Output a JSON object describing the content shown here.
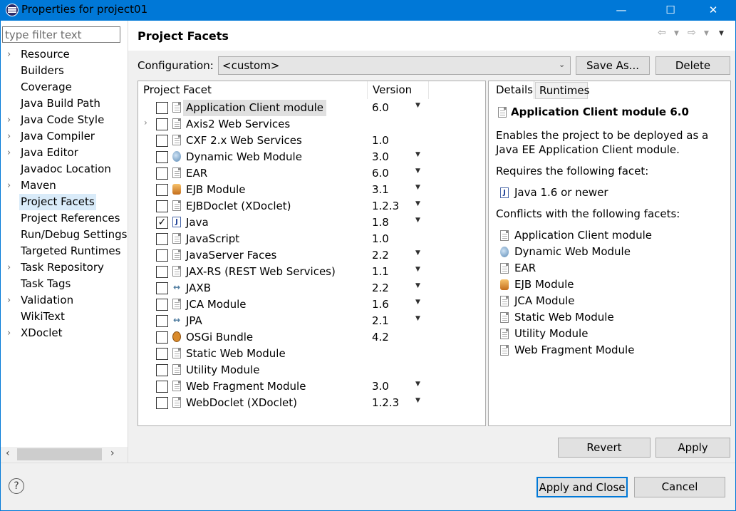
{
  "window": {
    "title": "Properties for project01",
    "minimize": "—",
    "maximize": "☐",
    "close": "✕"
  },
  "filter": {
    "placeholder": "type filter text"
  },
  "nav": [
    {
      "label": "Resource",
      "arrow": "›"
    },
    {
      "label": "Builders",
      "arrow": ""
    },
    {
      "label": "Coverage",
      "arrow": ""
    },
    {
      "label": "Java Build Path",
      "arrow": ""
    },
    {
      "label": "Java Code Style",
      "arrow": "›"
    },
    {
      "label": "Java Compiler",
      "arrow": "›"
    },
    {
      "label": "Java Editor",
      "arrow": "›"
    },
    {
      "label": "Javadoc Location",
      "arrow": ""
    },
    {
      "label": "Maven",
      "arrow": "›"
    },
    {
      "label": "Project Facets",
      "arrow": ""
    },
    {
      "label": "Project References",
      "arrow": ""
    },
    {
      "label": "Run/Debug Settings",
      "arrow": ""
    },
    {
      "label": "Targeted Runtimes",
      "arrow": ""
    },
    {
      "label": "Task Repository",
      "arrow": "›"
    },
    {
      "label": "Task Tags",
      "arrow": ""
    },
    {
      "label": "Validation",
      "arrow": "›"
    },
    {
      "label": "WikiText",
      "arrow": ""
    },
    {
      "label": "XDoclet",
      "arrow": "›"
    }
  ],
  "page": {
    "title": "Project Facets"
  },
  "config": {
    "label": "Configuration:",
    "value": "<custom>",
    "save_as": "Save As...",
    "delete": "Delete"
  },
  "table": {
    "col_facet": "Project Facet",
    "col_version": "Version"
  },
  "facets": [
    {
      "name": "Application Client module",
      "version": "6.0",
      "dropdown": true,
      "checked": false,
      "icon": "page-icon",
      "selected": true
    },
    {
      "name": "Axis2 Web Services",
      "version": "",
      "dropdown": false,
      "checked": false,
      "icon": "page-icon",
      "expander": true
    },
    {
      "name": "CXF 2.x Web Services",
      "version": "1.0",
      "dropdown": false,
      "checked": false,
      "icon": "page-icon"
    },
    {
      "name": "Dynamic Web Module",
      "version": "3.0",
      "dropdown": true,
      "checked": false,
      "icon": "globe-icon"
    },
    {
      "name": "EAR",
      "version": "6.0",
      "dropdown": true,
      "checked": false,
      "icon": "page-icon"
    },
    {
      "name": "EJB Module",
      "version": "3.1",
      "dropdown": true,
      "checked": false,
      "icon": "bean-icon"
    },
    {
      "name": "EJBDoclet (XDoclet)",
      "version": "1.2.3",
      "dropdown": true,
      "checked": false,
      "icon": "page-icon"
    },
    {
      "name": "Java",
      "version": "1.8",
      "dropdown": true,
      "checked": true,
      "icon": "java-icon"
    },
    {
      "name": "JavaScript",
      "version": "1.0",
      "dropdown": false,
      "checked": false,
      "icon": "page-icon"
    },
    {
      "name": "JavaServer Faces",
      "version": "2.2",
      "dropdown": true,
      "checked": false,
      "icon": "page-icon"
    },
    {
      "name": "JAX-RS (REST Web Services)",
      "version": "1.1",
      "dropdown": true,
      "checked": false,
      "icon": "page-icon"
    },
    {
      "name": "JAXB",
      "version": "2.2",
      "dropdown": true,
      "checked": false,
      "icon": "xml-binding-icon"
    },
    {
      "name": "JCA Module",
      "version": "1.6",
      "dropdown": true,
      "checked": false,
      "icon": "page-icon"
    },
    {
      "name": "JPA",
      "version": "2.1",
      "dropdown": true,
      "checked": false,
      "icon": "xml-binding-icon"
    },
    {
      "name": "OSGi Bundle",
      "version": "4.2",
      "dropdown": false,
      "checked": false,
      "icon": "osgi-icon"
    },
    {
      "name": "Static Web Module",
      "version": "",
      "dropdown": false,
      "checked": false,
      "icon": "page-icon"
    },
    {
      "name": "Utility Module",
      "version": "",
      "dropdown": false,
      "checked": false,
      "icon": "page-icon"
    },
    {
      "name": "Web Fragment Module",
      "version": "3.0",
      "dropdown": true,
      "checked": false,
      "icon": "page-icon"
    },
    {
      "name": "WebDoclet (XDoclet)",
      "version": "1.2.3",
      "dropdown": true,
      "checked": false,
      "icon": "page-icon"
    }
  ],
  "details": {
    "tab_details": "Details",
    "tab_runtimes": "Runtimes",
    "title": "Application Client module 6.0",
    "description": "Enables the project to be deployed as a Java EE Application Client module.",
    "requires_label": "Requires the following facet:",
    "requires": [
      {
        "name": "Java 1.6 or newer",
        "icon": "java-icon"
      }
    ],
    "conflicts_label": "Conflicts with the following facets:",
    "conflicts": [
      {
        "name": "Application Client module",
        "icon": "page-icon"
      },
      {
        "name": "Dynamic Web Module",
        "icon": "globe-icon"
      },
      {
        "name": "EAR",
        "icon": "page-icon"
      },
      {
        "name": "EJB Module",
        "icon": "bean-icon"
      },
      {
        "name": "JCA Module",
        "icon": "page-icon"
      },
      {
        "name": "Static Web Module",
        "icon": "page-icon"
      },
      {
        "name": "Utility Module",
        "icon": "page-icon"
      },
      {
        "name": "Web Fragment Module",
        "icon": "page-icon"
      }
    ]
  },
  "buttons": {
    "revert": "Revert",
    "apply": "Apply",
    "apply_close": "Apply and Close",
    "cancel": "Cancel",
    "help": "?"
  }
}
